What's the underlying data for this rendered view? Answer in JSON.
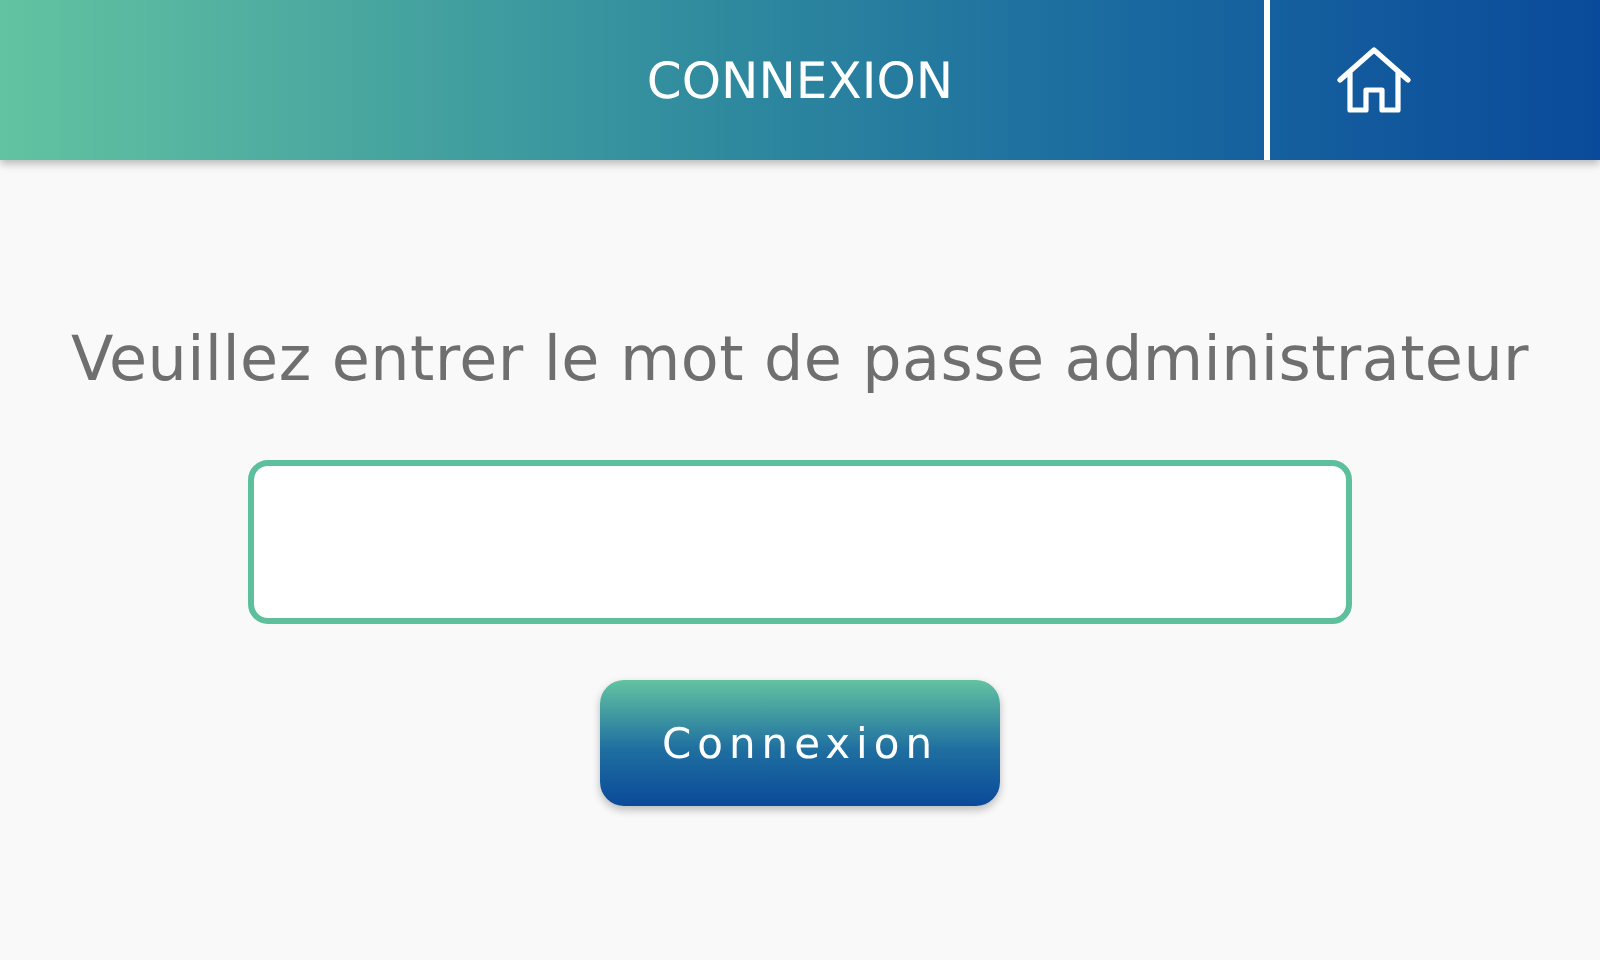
{
  "header": {
    "title": "CONNEXION"
  },
  "prompt": "Veuillez entrer le mot de passe administrateur",
  "buttons": [
    "Connexion"
  ]
}
